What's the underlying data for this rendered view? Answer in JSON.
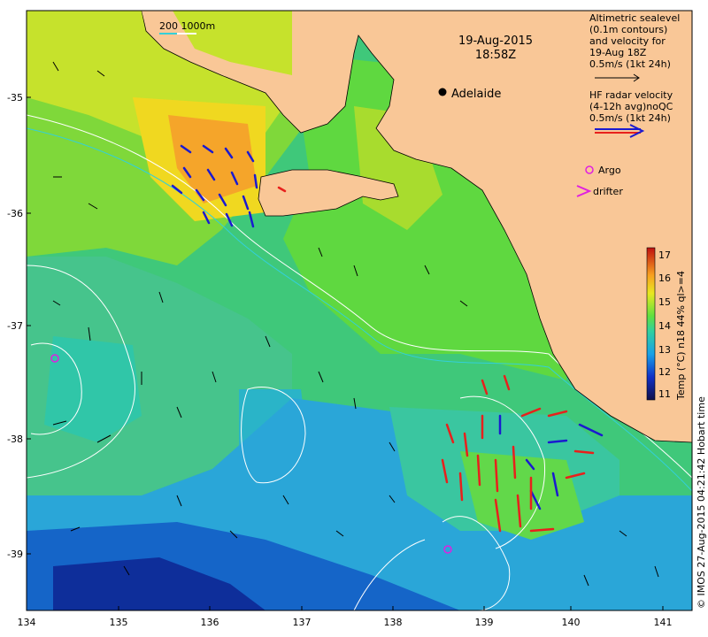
{
  "map": {
    "date": "19-Aug-2015",
    "time": "18:58Z",
    "place_label": "Adelaide",
    "scale_label": "200  1000m",
    "lon_ticks": [
      "134",
      "135",
      "136",
      "137",
      "138",
      "139",
      "140",
      "141"
    ],
    "lat_ticks": [
      "-35",
      "-36",
      "-37",
      "-38",
      "-39"
    ],
    "legend": {
      "sealevel_lines": [
        "Altimetric sealevel",
        "(0.1m contours)",
        "and velocity for",
        "19-Aug 18Z",
        "0.5m/s (1kt 24h)"
      ],
      "hf_lines": [
        "HF radar velocity",
        "(4-12h avg)noQC",
        "0.5m/s (1kt 24h)"
      ],
      "argo_label": "Argo",
      "drifter_label": "drifter"
    },
    "colorbar": {
      "ticks": [
        "11",
        "12",
        "13",
        "14",
        "15",
        "16",
        "17"
      ],
      "label": "Temp (°C) n18 44% ql>=4"
    },
    "credit": "© IMOS 27-Aug-2015 04:21:42 Hobart time",
    "colors": {
      "land": "#f9c797",
      "hf_radar_red": "#e8201c",
      "hf_radar_blue": "#1a1ad0",
      "argo_marker": "#e020e0",
      "contour": "#ffffff",
      "bathymetry": "#33d0d8"
    }
  }
}
